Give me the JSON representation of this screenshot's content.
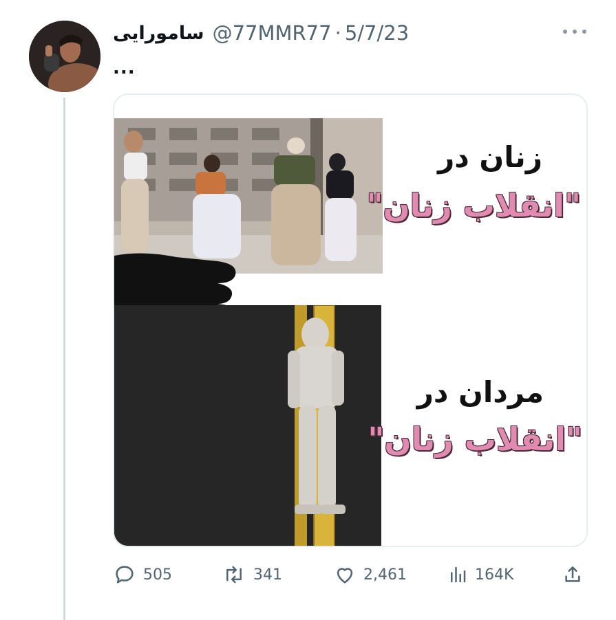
{
  "tweet": {
    "author_name": "سامورایی",
    "handle": "@77MMR77",
    "separator": "·",
    "date": "5/7/23",
    "text": "..."
  },
  "media": {
    "caption_top_line1": "زنان در",
    "caption_top_line2": "\"انقلاب زنان\"",
    "caption_bottom_line1": "مردان در",
    "caption_bottom_line2": "\"انقلاب زنان\""
  },
  "actions": {
    "replies": "505",
    "retweets": "341",
    "likes": "2,461",
    "views": "164K"
  },
  "colors": {
    "text_primary": "#0f1419",
    "text_secondary": "#536471",
    "caption_pink": "#e28bb2",
    "thread_line": "#cfd9de"
  },
  "icons": [
    "more-icon",
    "reply-icon",
    "retweet-icon",
    "like-icon",
    "views-icon",
    "share-icon"
  ]
}
